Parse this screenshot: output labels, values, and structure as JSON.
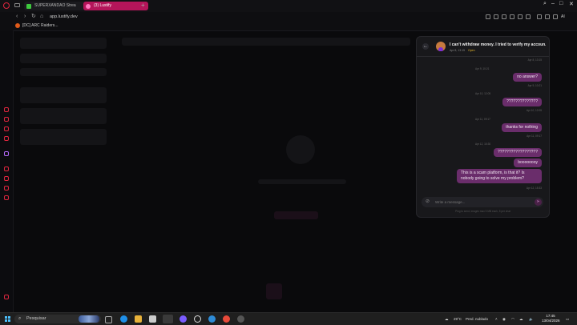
{
  "browser": {
    "tabs": [
      {
        "label": "SUPERXANDAO Strea"
      },
      {
        "label": "(3) Lustify"
      }
    ],
    "new_tab": "+",
    "window_controls": {
      "minimize": "–",
      "maximize": "□",
      "close": "✕"
    },
    "nav": {
      "back": "‹",
      "forward": "›",
      "reload": "↻",
      "home": "⌂"
    },
    "url": "app.lustify.dev",
    "ai_label": "AI",
    "bookmarks": [
      {
        "label": "[DC] ARC Raiders..."
      }
    ]
  },
  "chat": {
    "back": "←",
    "title": "I can't withdraw money. I tried to verify my accoun...",
    "date": "Apr 8, 13:15",
    "status": "Open",
    "messages": [
      {
        "text": "no answer?",
        "ts_before": "Apr 9, 10:21",
        "ts_after": "Apr 9, 10:21"
      },
      {
        "text": "??????????????",
        "ts_before": "Apr 10, 12:05",
        "ts_after": "Apr 10, 12:05"
      },
      {
        "text": "thanks for nothing",
        "ts_before": "Apr 11, 09:17",
        "ts_after": "Apr 11, 09:17"
      },
      {
        "text": "??????????????????",
        "ts_before": "Apr 12, 15:30",
        "ts_after": null
      },
      {
        "text": "boooooooy",
        "ts_before": null,
        "ts_after": null
      },
      {
        "text": "This is a scam platform, is that it? Is nobody going to solve my problem?",
        "ts_before": null,
        "ts_after": "Apr 12, 15:33"
      }
    ],
    "top_ts": "Apr 8, 13:15",
    "composer_placeholder": "Write a message...",
    "send": "➤",
    "attach": "⊘",
    "hint": "Ping to send, images max 5 MB each, 5 per chat"
  },
  "taskbar": {
    "search_placeholder": "Pesquisar",
    "weather": "29°C",
    "weather_desc": "Pred. nublado",
    "time": "17:45",
    "date": "13/04/2026"
  },
  "colors": {
    "accent": "#b4155a",
    "bubble": "#6a2d6b",
    "opera": "#e0263f"
  }
}
